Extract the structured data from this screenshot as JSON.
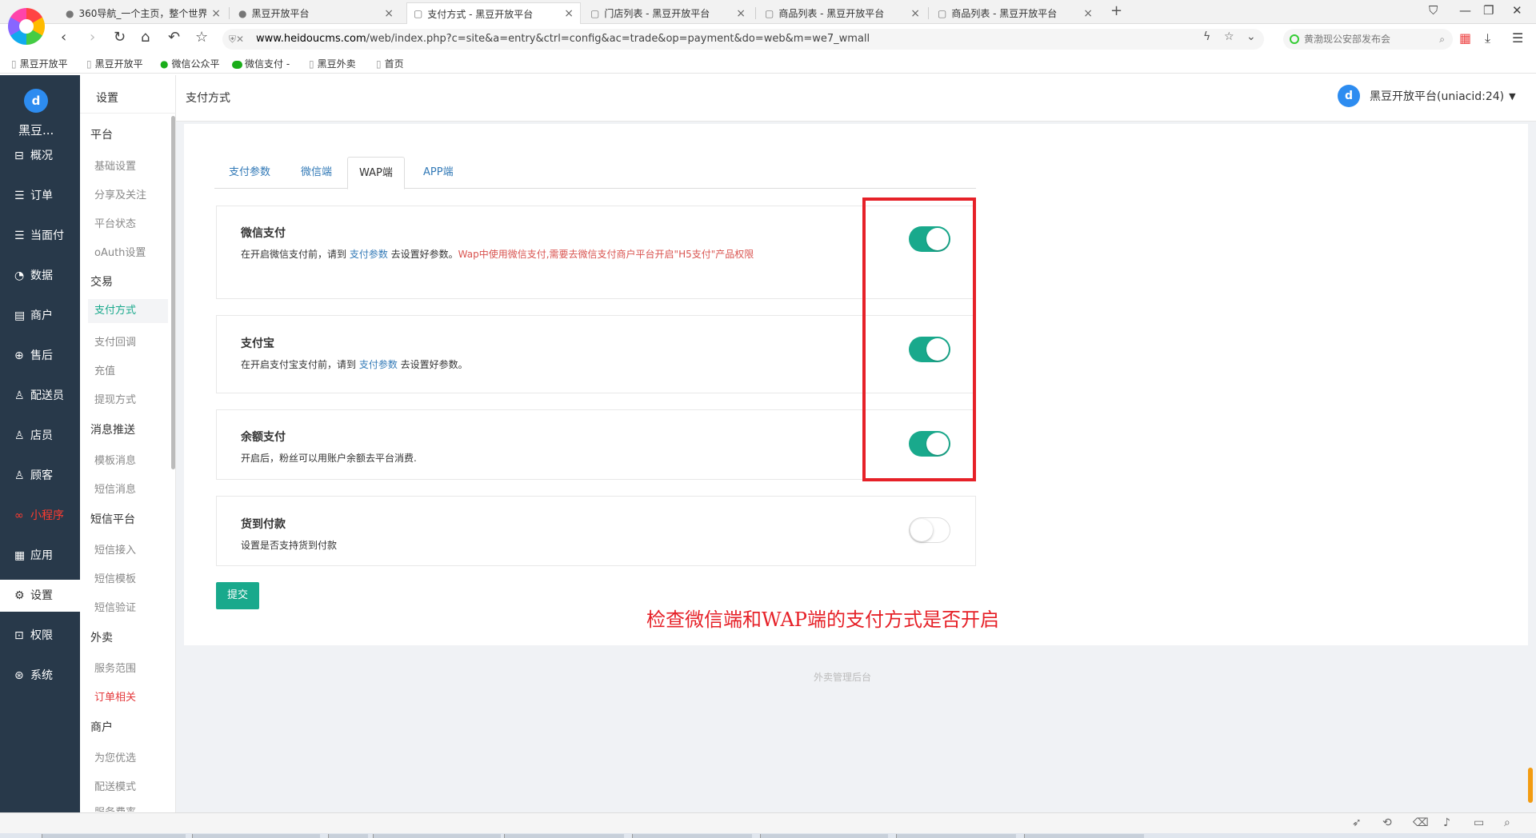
{
  "browser": {
    "tabs": [
      {
        "icon": "●",
        "title": "360导航_一个主页，整个世界"
      },
      {
        "icon": "●",
        "title": "黑豆开放平台"
      },
      {
        "icon": "▢",
        "title": "支付方式 - 黑豆开放平台"
      },
      {
        "icon": "▢",
        "title": "门店列表 - 黑豆开放平台"
      },
      {
        "icon": "▢",
        "title": "商品列表 - 黑豆开放平台"
      },
      {
        "icon": "▢",
        "title": "商品列表 - 黑豆开放平台"
      }
    ],
    "url_host": "www.heidoucms.com",
    "url_path": "/web/index.php?c=site&a=entry&ctrl=config&ac=trade&op=payment&do=web&m=we7_wmall",
    "news_text": "黄渤现公安部发布会",
    "bookmarks": [
      {
        "label": "黑豆开放平"
      },
      {
        "label": "黑豆开放平"
      },
      {
        "label": "微信公众平"
      },
      {
        "label": "微信支付 -"
      },
      {
        "label": "黑豆外卖"
      },
      {
        "label": "首页"
      }
    ]
  },
  "sidebar": {
    "brand_name": "黑豆...",
    "items": [
      {
        "icon": "⊟",
        "label": "概况"
      },
      {
        "icon": "☰",
        "label": "订单"
      },
      {
        "icon": "☰",
        "label": "当面付"
      },
      {
        "icon": "◔",
        "label": "数据"
      },
      {
        "icon": "▤",
        "label": "商户"
      },
      {
        "icon": "⊕",
        "label": "售后"
      },
      {
        "icon": "♙",
        "label": "配送员"
      },
      {
        "icon": "♙",
        "label": "店员"
      },
      {
        "icon": "♙",
        "label": "顾客"
      },
      {
        "icon": "∞",
        "label": "小程序"
      },
      {
        "icon": "▦",
        "label": "应用"
      },
      {
        "icon": "⚙",
        "label": "设置"
      },
      {
        "icon": "⊡",
        "label": "权限"
      },
      {
        "icon": "⊛",
        "label": "系统"
      }
    ]
  },
  "subnav": {
    "title": "设置",
    "groups": [
      {
        "label": "平台",
        "items": [
          "基础设置",
          "分享及关注",
          "平台状态",
          "oAuth设置"
        ]
      },
      {
        "label": "交易",
        "items": [
          "支付方式",
          "支付回调",
          "充值",
          "提现方式"
        ]
      },
      {
        "label": "消息推送",
        "items": [
          "模板消息",
          "短信消息"
        ]
      },
      {
        "label": "短信平台",
        "items": [
          "短信接入",
          "短信模板",
          "短信验证"
        ]
      },
      {
        "label": "外卖",
        "items": [
          "服务范围",
          "订单相关"
        ]
      },
      {
        "label": "商户",
        "items": [
          "为您优选",
          "配送模式",
          "服务费率"
        ]
      }
    ]
  },
  "header": {
    "page_title": "支付方式",
    "user": "黑豆开放平台(uniacid:24)"
  },
  "tabs": [
    "支付参数",
    "微信端",
    "WAP端",
    "APP端"
  ],
  "payments": [
    {
      "title": "微信支付",
      "desc_pre": "在开启微信支付前，请到 ",
      "link": "支付参数",
      "desc_post": " 去设置好参数。",
      "warn": "Wap中使用微信支付,需要去微信支付商户平台开启\"H5支付\"产品权限",
      "enabled": true
    },
    {
      "title": "支付宝",
      "desc_pre": "在开启支付宝支付前，请到 ",
      "link": "支付参数",
      "desc_post": " 去设置好参数。",
      "warn": "",
      "enabled": true
    },
    {
      "title": "余额支付",
      "desc_pre": "开启后，粉丝可以用账户余额去平台消费.",
      "link": "",
      "desc_post": "",
      "warn": "",
      "enabled": true
    },
    {
      "title": "货到付款",
      "desc_pre": "设置是否支持货到付款",
      "link": "",
      "desc_post": "",
      "warn": "",
      "enabled": false
    }
  ],
  "submit_label": "提交",
  "annotation": "检查微信端和WAP端的支付方式是否开启",
  "footer": "外卖管理后台",
  "colors": {
    "primary": "#19a98c",
    "sidebar": "#28394a",
    "annotation": "#e62128",
    "link": "#337ab7"
  }
}
